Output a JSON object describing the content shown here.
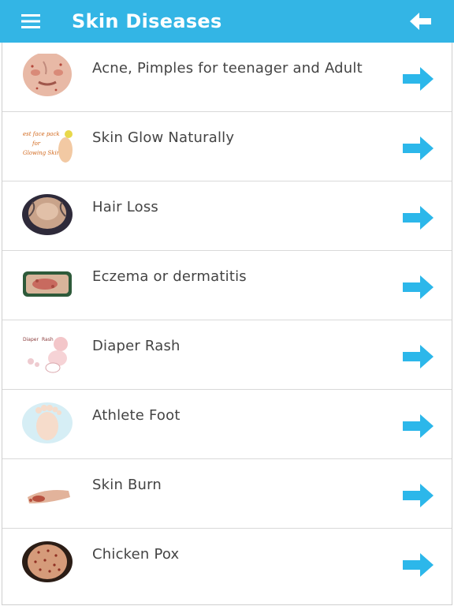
{
  "header": {
    "title": "Skin Diseases",
    "color": "#33b5e5"
  },
  "icons": {
    "menu": "hamburger-menu-icon",
    "back": "back-arrow-icon",
    "item_arrow": "right-arrow-icon"
  },
  "items": [
    {
      "label": "Acne, Pimples for teenager and Adult",
      "thumb": "acne-face"
    },
    {
      "label": "Skin Glow Naturally",
      "thumb": "skin-glow"
    },
    {
      "label": "Hair Loss",
      "thumb": "hair-loss"
    },
    {
      "label": "Eczema or dermatitis",
      "thumb": "eczema"
    },
    {
      "label": "Diaper Rash",
      "thumb": "diaper-rash"
    },
    {
      "label": "Athlete Foot",
      "thumb": "athlete-foot"
    },
    {
      "label": "Skin Burn",
      "thumb": "skin-burn"
    },
    {
      "label": "Chicken Pox",
      "thumb": "chicken-pox"
    }
  ]
}
